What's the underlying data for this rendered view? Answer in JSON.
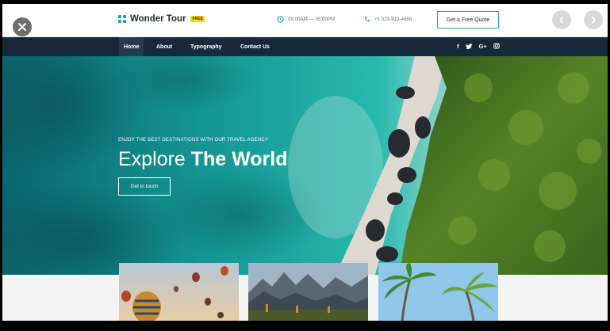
{
  "brand": {
    "name": "Wonder Tour",
    "badge": "FREE"
  },
  "header": {
    "hours": "09:00AM — 05:00PM",
    "phone": "+1 323-913-4688",
    "quote_button": "Get a Free Quote"
  },
  "nav": {
    "items": [
      {
        "label": "Home",
        "active": true
      },
      {
        "label": "About",
        "active": false
      },
      {
        "label": "Typography",
        "active": false
      },
      {
        "label": "Contact Us",
        "active": false
      }
    ],
    "social": [
      "f",
      "t",
      "G+",
      "ig"
    ]
  },
  "hero": {
    "tagline": "ENJOY THE BEST DESTINATIONS WITH OUR TRAVEL AGENCY",
    "headline_light": "Explore ",
    "headline_bold": "The World",
    "button": "Get in touch"
  },
  "colors": {
    "accent": "#24a3a7",
    "nav_bg": "#16293a",
    "badge": "#f5d90a"
  },
  "icons": [
    "close-icon",
    "chevron-left-icon",
    "chevron-right-icon",
    "clock-icon",
    "phone-icon",
    "facebook-icon",
    "twitter-icon",
    "google-plus-icon",
    "instagram-icon"
  ]
}
